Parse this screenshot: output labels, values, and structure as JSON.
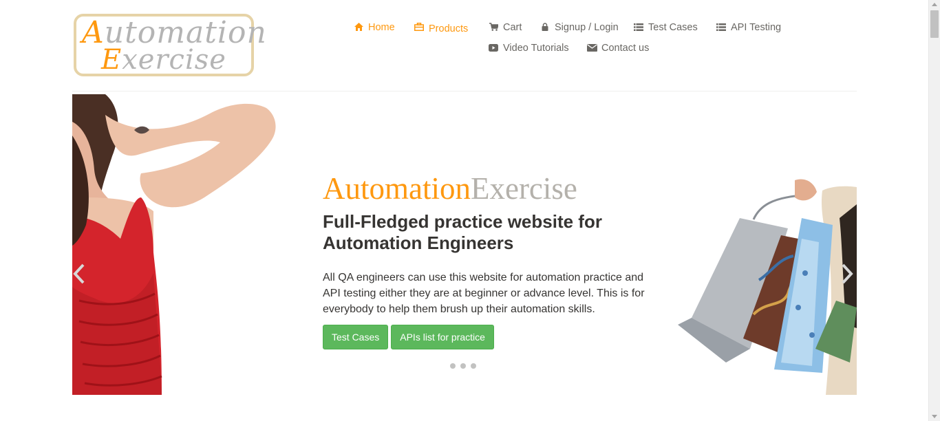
{
  "logo": {
    "line1_initial": "A",
    "line1_rest": "utomation",
    "line2_initial": "E",
    "line2_rest": "xercise"
  },
  "nav": {
    "home": "Home",
    "products": "Products",
    "cart": "Cart",
    "signup_login": "Signup / Login",
    "test_cases": "Test Cases",
    "api_testing": "API Testing",
    "video_tutorials": "Video Tutorials",
    "contact_us": "Contact us"
  },
  "hero": {
    "title_part1": "Automation",
    "title_part2": "Exercise",
    "subtitle": "Full-Fledged practice website for Automation Engineers",
    "description": "All QA engineers can use this website for automation practice and API testing either they are at beginner or advance level. This is for everybody to help them brush up their automation skills.",
    "button_test_cases": "Test Cases",
    "button_apis": "APIs list for practice"
  },
  "colors": {
    "accent": "#fe980f",
    "button_green": "#5cb85c",
    "text_dark": "#363432",
    "text_gray": "#696763"
  },
  "icons": {
    "home": "home-icon",
    "products": "shopping-bag-icon",
    "cart": "cart-icon",
    "signup": "lock-icon",
    "test_cases": "list-icon",
    "api_testing": "list-icon",
    "video": "youtube-play-icon",
    "contact": "envelope-icon"
  }
}
